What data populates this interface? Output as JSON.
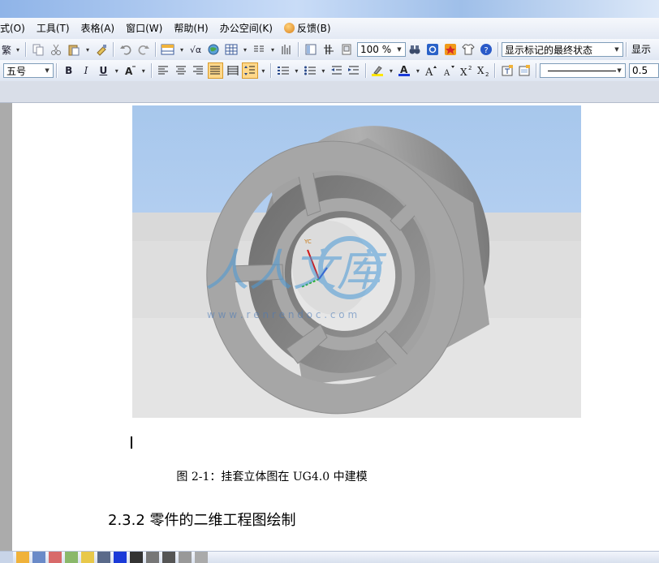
{
  "menubar": {
    "items": [
      {
        "label": "式(O)"
      },
      {
        "label": "工具(T)"
      },
      {
        "label": "表格(A)"
      },
      {
        "label": "窗口(W)"
      },
      {
        "label": "帮助(H)"
      },
      {
        "label": "办公空间(K)"
      },
      {
        "label": "反馈(B)"
      }
    ]
  },
  "toolbar1": {
    "trad_label": "繁",
    "zoom_value": "100 %",
    "markup_value": "显示标记的最终状态",
    "show_label": "显示"
  },
  "toolbar2": {
    "font_size_value": "五号",
    "bold": "B",
    "italic": "I",
    "underline": "U",
    "line_weight_value": "0.5"
  },
  "document": {
    "figure_caption": "图 2-1：挂套立体图在 UG4.0 中建模",
    "section_heading": "2.3.2 零件的二维工程图绘制",
    "watermark_text": "人人文库",
    "watermark_url": "w w w . r e n r e n d o c . c o m"
  },
  "colors": {
    "sky": "#a9c9ee",
    "floor": "#e3e3e3",
    "part": "#a3a3a3",
    "active_button": "#ffd88a"
  }
}
